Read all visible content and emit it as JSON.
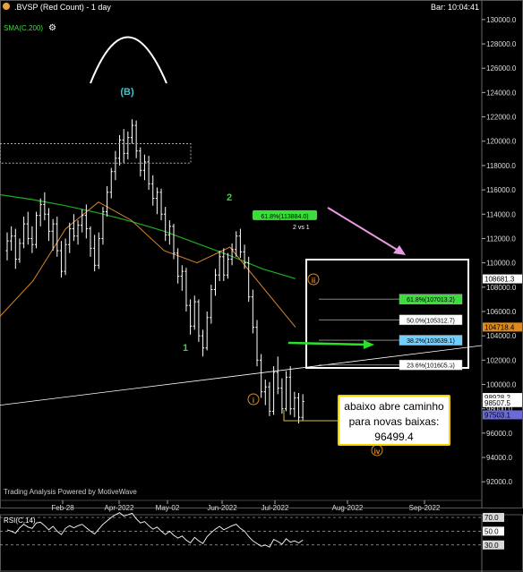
{
  "header": {
    "symbol_title": ".BVSP (Red Count) - 1 day",
    "bar_time": "Bar: 10:04:41",
    "sma_label": "SMA(C,200)",
    "watermark": "Trading Analysis Powered by MotiveWave",
    "rsi_label": "RSI(C,14)"
  },
  "note": {
    "line1": "abaixo abre caminho",
    "line2": "para novas baixas:",
    "line3": "96499.4"
  },
  "colors": {
    "background": "#000000",
    "candle": "#ffffff",
    "sma_green": "#1fae1f",
    "ma_orange": "#d9852a",
    "wave_cyan": "#39c7d3",
    "wave_green": "#36d436",
    "wave_orange": "#e08a1e",
    "fib_green": "#3ddc3d",
    "fib_blue": "#6fd0ff",
    "note_border": "#f5d200",
    "arrow_pink": "#e79be0"
  },
  "chart_data": {
    "type": "candlestick",
    "ylim": [
      91500,
      130800
    ],
    "x_tick_labels": [
      "Feb-28",
      "Apr-2022",
      "May-02",
      "Jun-2022",
      "Jul-2022",
      "Aug-2022",
      "Sep-2022"
    ],
    "y_tick_labels": [
      "130000.0",
      "128000.0",
      "126000.0",
      "124000.0",
      "122000.0",
      "120000.0",
      "118000.0",
      "116000.0",
      "114000.0",
      "112000.0",
      "110000.0",
      "108000.0",
      "106000.0",
      "104000.0",
      "102000.0",
      "100000.0",
      "98000.0",
      "96000.0",
      "94000.0",
      "92000.0"
    ],
    "price_tags": [
      {
        "label": "108681.3",
        "value": 108681.3,
        "color": "#ffffff",
        "text": "#000000"
      },
      {
        "label": "104718.4",
        "value": 104718.4,
        "color": "#e08a1e",
        "text": "#000000"
      },
      {
        "label": "98928.2",
        "value": 98928.2,
        "color": "#ffffff",
        "text": "#000000"
      },
      {
        "label": "98507.5",
        "value": 98507.5,
        "color": "#ffffff",
        "text": "#000000"
      },
      {
        "label": "97503.1",
        "value": 97503.1,
        "color": "#6a6ad8",
        "text": "#000000"
      }
    ],
    "wave_labels": [
      {
        "label": "(B)",
        "color": "#39c7d3",
        "circled": false
      },
      {
        "label": "1",
        "color": "#36d436",
        "circled": false
      },
      {
        "label": "2",
        "color": "#36d436",
        "circled": false
      },
      {
        "label": "i",
        "color": "#e08a1e",
        "circled": true
      },
      {
        "label": "ii",
        "color": "#e08a1e",
        "circled": true
      },
      {
        "label": "iv",
        "color": "#e08a1e",
        "circled": true
      }
    ],
    "fib_top": {
      "label": "61.8%(113884.0)",
      "value": 113884.0,
      "relation": "2 vs 1"
    },
    "fib_box": {
      "relation": "2 vs 1",
      "levels": [
        {
          "label": "61.8%(107013.2)",
          "value": 107013.2,
          "color": "#3ddc3d"
        },
        {
          "label": "50.0%(105312.7)",
          "value": 105312.7,
          "color": "#ffffff"
        },
        {
          "label": "38.2%(103639.1)",
          "value": 103639.1,
          "color": "#6fd0ff"
        },
        {
          "label": "23.6%(101605.3)",
          "value": 101605.3,
          "color": "#ffffff"
        }
      ]
    },
    "series": [
      {
        "name": "SMA(C,200)",
        "values": [
          115600,
          115200,
          114700,
          114100,
          113400,
          112600,
          111600,
          110600,
          109500,
          108700
        ]
      },
      {
        "name": "MA",
        "values": [
          105600,
          108500,
          112800,
          115000,
          113500,
          111000,
          110000,
          111300,
          108000,
          104700
        ]
      }
    ],
    "candles": [
      [
        111000,
        112500,
        110200,
        111800
      ],
      [
        111800,
        113000,
        111000,
        112200
      ],
      [
        112200,
        112800,
        109500,
        110300
      ],
      [
        110300,
        112000,
        110000,
        111600
      ],
      [
        111600,
        113800,
        111200,
        113200
      ],
      [
        113200,
        114200,
        111500,
        112000
      ],
      [
        112000,
        113000,
        110800,
        111500
      ],
      [
        111500,
        114200,
        111200,
        113900
      ],
      [
        113900,
        115300,
        113000,
        114800
      ],
      [
        114800,
        115800,
        113500,
        114000
      ],
      [
        114000,
        114500,
        111800,
        112600
      ],
      [
        112600,
        113600,
        111000,
        113200
      ],
      [
        113200,
        113800,
        110500,
        111000
      ],
      [
        111000,
        111800,
        108800,
        109300
      ],
      [
        109300,
        112000,
        109000,
        111500
      ],
      [
        111500,
        113300,
        110800,
        112800
      ],
      [
        112800,
        114000,
        111800,
        112200
      ],
      [
        112200,
        113500,
        111500,
        113100
      ],
      [
        113100,
        114400,
        112500,
        113900
      ],
      [
        113900,
        114800,
        112000,
        112800
      ],
      [
        112800,
        113000,
        110500,
        111200
      ],
      [
        111200,
        112300,
        109300,
        109800
      ],
      [
        109800,
        112500,
        109500,
        112000
      ],
      [
        112000,
        114600,
        111500,
        114200
      ],
      [
        114200,
        116300,
        113800,
        115800
      ],
      [
        115800,
        117800,
        115300,
        117500
      ],
      [
        117500,
        119200,
        116800,
        118600
      ],
      [
        118600,
        120500,
        118000,
        120100
      ],
      [
        120100,
        121000,
        118200,
        119000
      ],
      [
        119000,
        120800,
        118500,
        120300
      ],
      [
        120300,
        121800,
        119800,
        121300
      ],
      [
        121300,
        121700,
        118600,
        119200
      ],
      [
        119200,
        119500,
        117100,
        117600
      ],
      [
        117600,
        118900,
        116800,
        118300
      ],
      [
        118300,
        118800,
        116000,
        116500
      ],
      [
        116500,
        117200,
        114700,
        115300
      ],
      [
        115300,
        116200,
        114000,
        115800
      ],
      [
        115800,
        116100,
        113500,
        114000
      ],
      [
        114000,
        114600,
        111800,
        112300
      ],
      [
        112300,
        113500,
        111500,
        113000
      ],
      [
        113000,
        113200,
        110300,
        110800
      ],
      [
        110800,
        111200,
        108300,
        108900
      ],
      [
        108900,
        109800,
        107700,
        109300
      ],
      [
        109300,
        109600,
        106000,
        106500
      ],
      [
        106500,
        107000,
        104100,
        104800
      ],
      [
        104800,
        107300,
        104500,
        106800
      ],
      [
        106800,
        107000,
        103500,
        104000
      ],
      [
        104000,
        104500,
        102300,
        103000
      ],
      [
        103000,
        106000,
        102800,
        105500
      ],
      [
        105500,
        108200,
        105000,
        107800
      ],
      [
        107800,
        109500,
        107300,
        109000
      ],
      [
        109000,
        111000,
        108500,
        110500
      ],
      [
        110500,
        111200,
        108500,
        109000
      ],
      [
        109000,
        110800,
        108700,
        110300
      ],
      [
        110300,
        111600,
        109800,
        111100
      ],
      [
        111100,
        112600,
        110500,
        112200
      ],
      [
        112200,
        112800,
        110400,
        110900
      ],
      [
        110900,
        111500,
        109500,
        110000
      ],
      [
        110000,
        110500,
        106800,
        107200
      ],
      [
        107200,
        107800,
        104200,
        104700
      ],
      [
        104700,
        105300,
        101500,
        102000
      ],
      [
        102000,
        102500,
        98900,
        99400
      ],
      [
        99400,
        100400,
        98300,
        99800
      ],
      [
        99800,
        100200,
        97400,
        97800
      ],
      [
        97800,
        101500,
        97500,
        101000
      ],
      [
        101000,
        102300,
        99200,
        99700
      ],
      [
        99700,
        100500,
        97600,
        98000
      ],
      [
        98000,
        101100,
        97800,
        100600
      ],
      [
        100600,
        101500,
        97500,
        98000
      ],
      [
        98000,
        99400,
        97300,
        98900
      ],
      [
        98900,
        99300,
        96800,
        97300
      ],
      [
        97300,
        99200,
        97000,
        98600
      ]
    ],
    "rsi": {
      "label": "RSI(C,14)",
      "tick_labels": [
        "70.0",
        "50.0",
        "30.0"
      ],
      "levels": [
        70,
        50,
        30
      ],
      "values": [
        52,
        50,
        47,
        55,
        60,
        56,
        54,
        62,
        63,
        58,
        52,
        57,
        50,
        45,
        54,
        58,
        55,
        58,
        60,
        55,
        50,
        46,
        53,
        60,
        65,
        70,
        74,
        77,
        72,
        74,
        76,
        68,
        62,
        64,
        58,
        53,
        56,
        50,
        45,
        50,
        44,
        40,
        43,
        37,
        33,
        41,
        36,
        32,
        42,
        48,
        53,
        57,
        52,
        55,
        58,
        60,
        54,
        50,
        42,
        36,
        32,
        28,
        30,
        27,
        38,
        35,
        31,
        39,
        34,
        36,
        33,
        37
      ]
    }
  }
}
